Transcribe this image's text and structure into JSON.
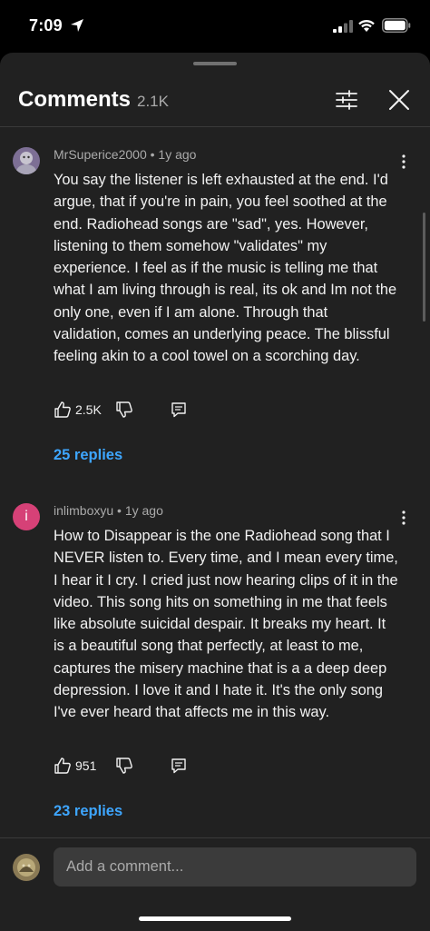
{
  "status_bar": {
    "time": "7:09"
  },
  "header": {
    "title": "Comments",
    "count": "2.1K"
  },
  "comments": [
    {
      "author": "MrSuperice2000",
      "age": "1y ago",
      "text": "You say the listener is left exhausted at the end. I'd argue, that if you're in pain, you feel soothed at the end. Radiohead songs are \"sad\", yes. However, listening to them somehow \"validates\" my experience. I feel as if the music is telling me that what I am living through is real, its ok and Im not the only one, even if I am alone. Through that validation, comes an underlying peace. The blissful feeling akin to a cool towel on a scorching day.",
      "likes": "2.5K",
      "replies": "25 replies"
    },
    {
      "author": "inlimboxyu",
      "age": "1y ago",
      "avatar_letter": "i",
      "text": "How to Disappear is the one Radiohead song that I NEVER listen to. Every time, and I mean every time, I hear it I cry. I cried just now hearing clips of it in the video. This song hits on something in me that feels like absolute suicidal despair. It breaks my heart. It is a beautiful song that perfectly, at least to me, captures the misery machine that is a a deep deep depression. I love it and I hate it. It's the only song I've ever heard that affects me in this way.",
      "likes": "951",
      "replies": "23 replies"
    }
  ],
  "composer": {
    "placeholder": "Add a comment..."
  },
  "meta_separator": "•",
  "colors": {
    "background": "#212121",
    "link": "#3ea6ff",
    "avatar_pink": "#d64177"
  }
}
